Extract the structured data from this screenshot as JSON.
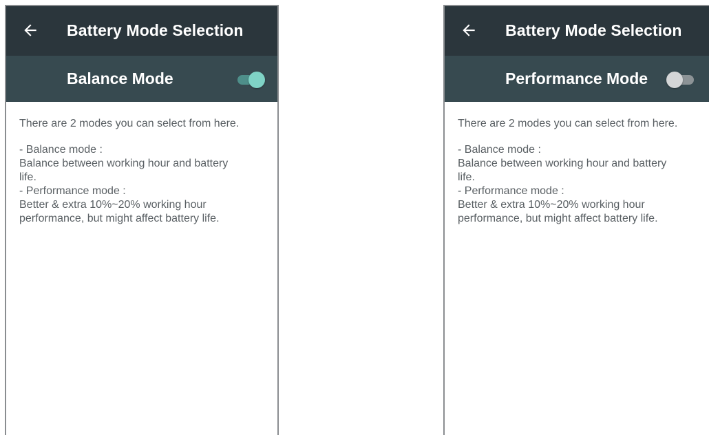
{
  "screens": [
    {
      "title": "Battery Mode Selection",
      "mode_label": "Balance Mode",
      "toggle_on": true,
      "intro": "There are 2 modes you can select from here.",
      "lines": [
        "- Balance mode :",
        "Balance between working hour and battery",
        "life.",
        "- Performance mode :",
        "Better & extra 10%~20% working hour",
        "performance, but might affect battery life."
      ]
    },
    {
      "title": "Battery Mode Selection",
      "mode_label": "Performance Mode",
      "toggle_on": false,
      "intro": "There are 2 modes you can select from here.",
      "lines": [
        "- Balance mode :",
        "Balance between working hour and battery",
        "life.",
        "- Performance mode :",
        "Better & extra 10%~20% working hour",
        "performance, but might affect battery life."
      ]
    }
  ],
  "colors": {
    "topbar": "#2b363c",
    "modebar": "#374a50",
    "toggle_on_knob": "#7fd3c6",
    "toggle_on_track": "#4e8f8a",
    "toggle_off_knob": "#d4d6d7",
    "toggle_off_track": "#8c9396",
    "body_text": "#595f63"
  },
  "icons": {
    "back": "arrow-left-icon"
  }
}
